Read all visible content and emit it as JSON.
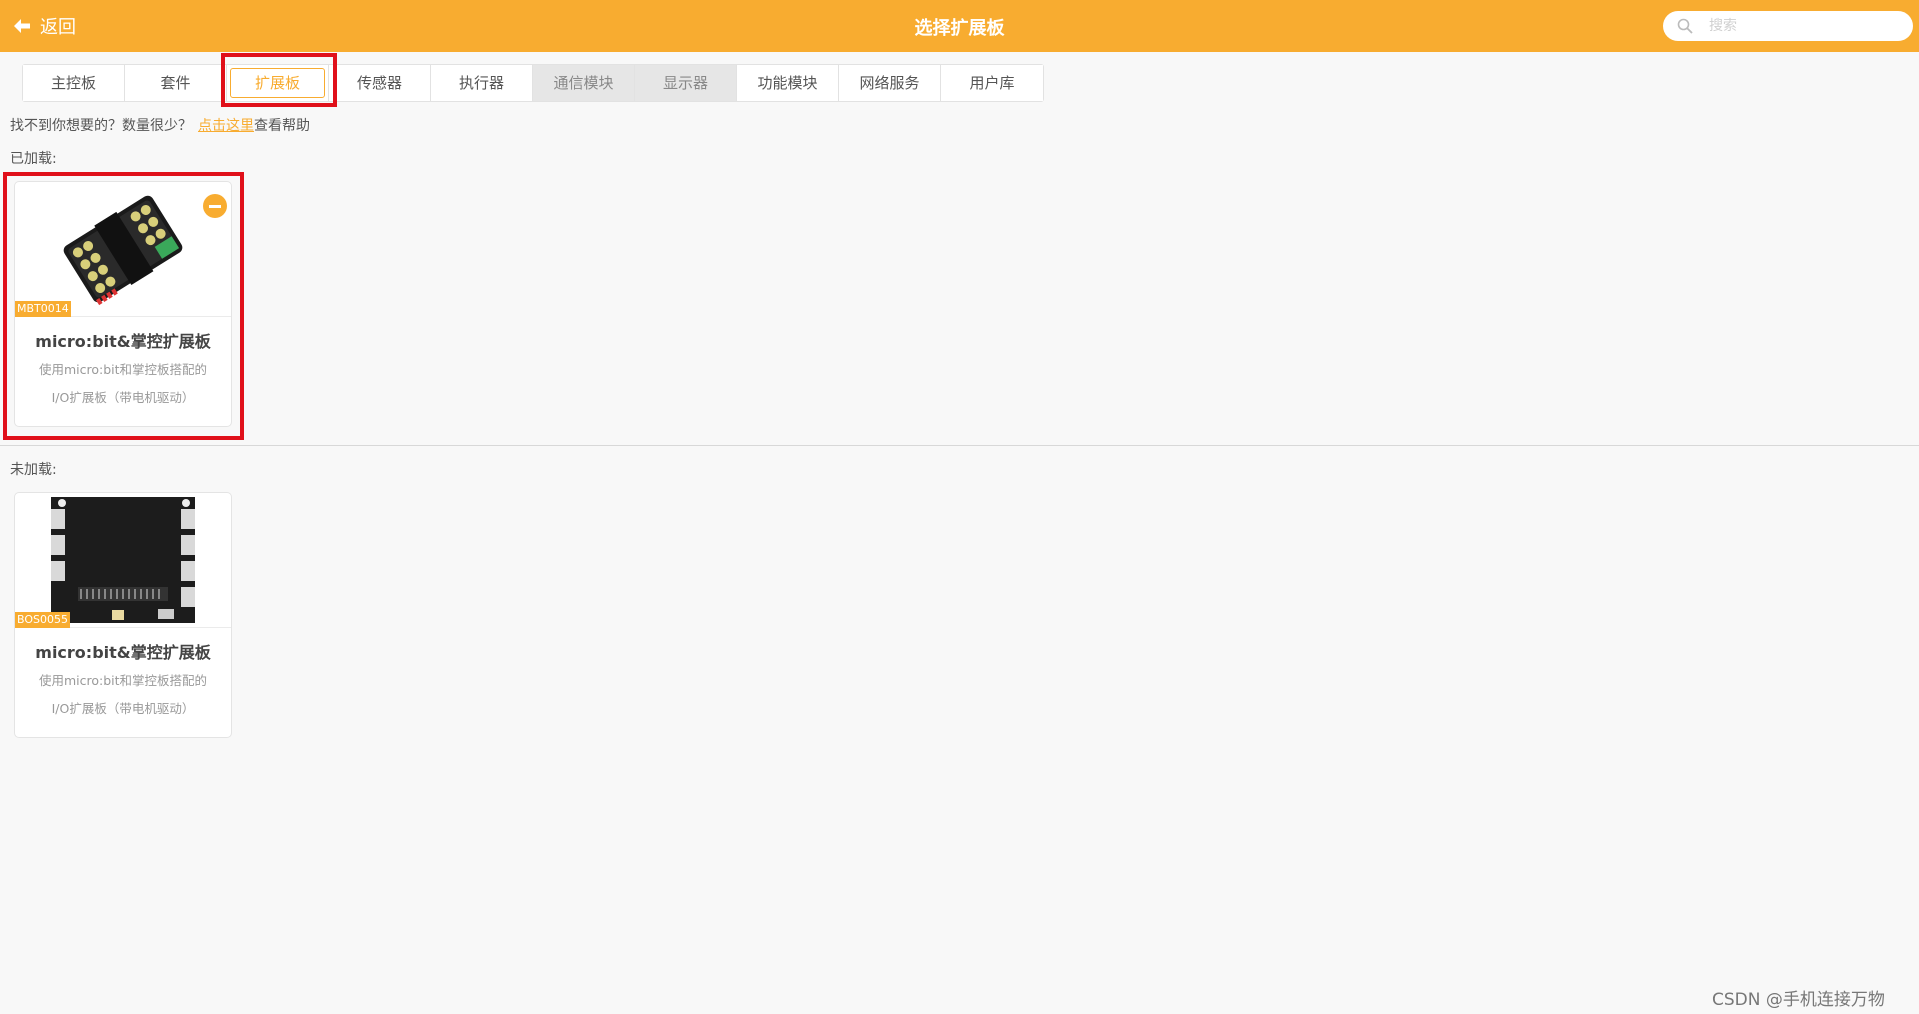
{
  "header": {
    "back_label": "返回",
    "title": "选择扩展板",
    "search_placeholder": "搜索"
  },
  "tabs": [
    {
      "label": "主控板",
      "state": "normal"
    },
    {
      "label": "套件",
      "state": "normal"
    },
    {
      "label": "扩展板",
      "state": "active"
    },
    {
      "label": "传感器",
      "state": "normal"
    },
    {
      "label": "执行器",
      "state": "normal"
    },
    {
      "label": "通信模块",
      "state": "disabled"
    },
    {
      "label": "显示器",
      "state": "disabled"
    },
    {
      "label": "功能模块",
      "state": "normal"
    },
    {
      "label": "网络服务",
      "state": "normal"
    },
    {
      "label": "用户库",
      "state": "normal"
    }
  ],
  "help": {
    "prefix": "找不到你想要的？数量很少？",
    "link": "点击这里",
    "suffix": "查看帮助"
  },
  "loaded": {
    "label": "已加载:",
    "cards": [
      {
        "code": "MBT0014",
        "name": "micro:bit&掌控扩展板",
        "desc_line1": "使用micro:bit和掌控板搭配的",
        "desc_line2": "I/O扩展板（带电机驱动）"
      }
    ]
  },
  "not_loaded": {
    "label": "未加载:",
    "cards": [
      {
        "code": "BOS0055",
        "name": "micro:bit&掌控扩展板",
        "desc_line1": "使用micro:bit和掌控板搭配的",
        "desc_line2": "I/O扩展板（带电机驱动）"
      }
    ]
  },
  "colors": {
    "accent": "#f8ac30",
    "highlight": "#e0101a",
    "background": "#f8f8f8"
  },
  "watermark": "CSDN @手机连接万物"
}
